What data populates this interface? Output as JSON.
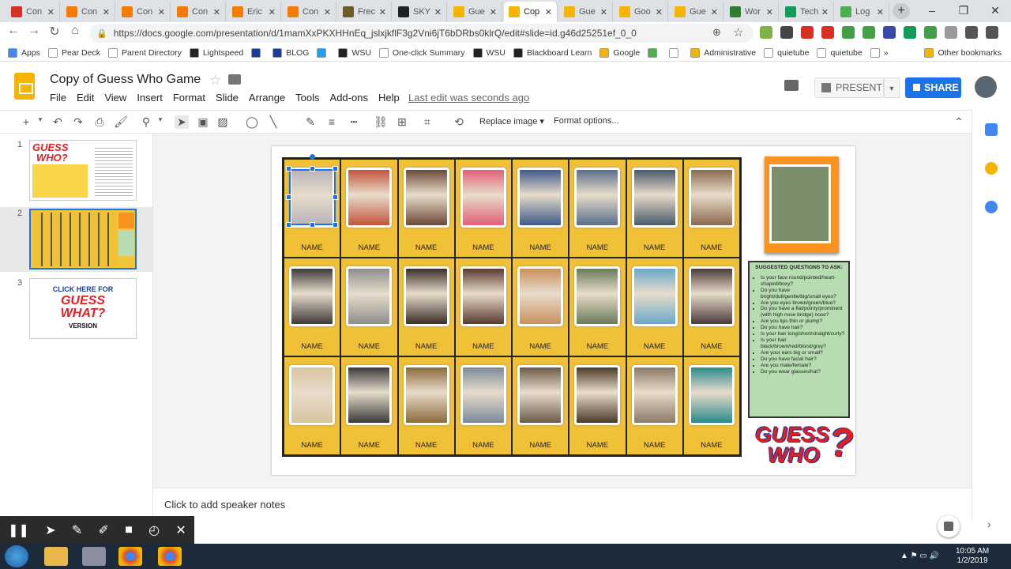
{
  "browser": {
    "tabs": [
      {
        "label": "Con",
        "color": "#d93025"
      },
      {
        "label": "Con",
        "color": "#f57c00"
      },
      {
        "label": "Con",
        "color": "#f57c00"
      },
      {
        "label": "Con",
        "color": "#f57c00"
      },
      {
        "label": "Eric",
        "color": "#f57c00"
      },
      {
        "label": "Con",
        "color": "#f57c00"
      },
      {
        "label": "Frec",
        "color": "#6d5a2a"
      },
      {
        "label": "SKY",
        "color": "#222222"
      },
      {
        "label": "Gue",
        "color": "#f4b400"
      },
      {
        "label": "Cop",
        "color": "#f4b400",
        "active": true
      },
      {
        "label": "Gue",
        "color": "#f4b400"
      },
      {
        "label": "Goo",
        "color": "#f4b400"
      },
      {
        "label": "Gue",
        "color": "#f4b400"
      },
      {
        "label": "Wor",
        "color": "#2e7d32"
      },
      {
        "label": "Tech",
        "color": "#0f9d58"
      },
      {
        "label": "Log",
        "color": "#4caf50"
      }
    ],
    "url": "https://docs.google.com/presentation/d/1mamXxPKXHHnEq_jslxjkflF3g2Vni6jT6bDRbs0klrQ/edit#slide=id.g46d25251ef_0_0",
    "bookmarks": [
      "Apps",
      "Pear Deck",
      "Parent Directory",
      "Lightspeed",
      "",
      "BLOG",
      "",
      "WSU",
      "One-click Summary",
      "WSU",
      "Blackboard Learn",
      "Google",
      "",
      "",
      "Administrative",
      "quietube",
      "quietube",
      "»",
      "Other bookmarks"
    ]
  },
  "doc": {
    "title": "Copy of Guess Who Game",
    "menus": [
      "File",
      "Edit",
      "View",
      "Insert",
      "Format",
      "Slide",
      "Arrange",
      "Tools",
      "Add-ons",
      "Help"
    ],
    "last_edit": "Last edit was seconds ago",
    "present_label": "PRESENT",
    "share_label": "SHARE"
  },
  "toolbar": {
    "replace_image": "Replace image ▾",
    "format_options": "Format options..."
  },
  "filmstrip": {
    "slides": [
      {
        "num": "1"
      },
      {
        "num": "2"
      },
      {
        "num": "3"
      }
    ],
    "slide1": {
      "logo1": "GUESS",
      "logo2": "WHO?"
    },
    "slide3": {
      "line1": "CLICK HERE FOR",
      "line2": "GUESS",
      "line3": "WHAT?",
      "line4": "VERSION"
    }
  },
  "slide": {
    "cards": [
      {
        "name": "NAME",
        "color": "#b9b3b8"
      },
      {
        "name": "NAME",
        "color": "#c2553a"
      },
      {
        "name": "NAME",
        "color": "#6b4a3a"
      },
      {
        "name": "NAME",
        "color": "#e0607a"
      },
      {
        "name": "NAME",
        "color": "#3e5a8a"
      },
      {
        "name": "NAME",
        "color": "#5a6f8a"
      },
      {
        "name": "NAME",
        "color": "#4a5a6a"
      },
      {
        "name": "NAME",
        "color": "#8a6a4e"
      },
      {
        "name": "NAME",
        "color": "#3e3a3a"
      },
      {
        "name": "NAME",
        "color": "#8e8e8e"
      },
      {
        "name": "NAME",
        "color": "#3a2f2a"
      },
      {
        "name": "NAME",
        "color": "#5a3a30"
      },
      {
        "name": "NAME",
        "color": "#c9905e"
      },
      {
        "name": "NAME",
        "color": "#6a7a5a"
      },
      {
        "name": "NAME",
        "color": "#6aa8c8"
      },
      {
        "name": "NAME",
        "color": "#4a3a3a"
      },
      {
        "name": "NAME",
        "color": "#d8c4a0"
      },
      {
        "name": "NAME",
        "color": "#3a3a3a"
      },
      {
        "name": "NAME",
        "color": "#8a6a3a"
      },
      {
        "name": "NAME",
        "color": "#7a8a9a"
      },
      {
        "name": "NAME",
        "color": "#6a5a4a"
      },
      {
        "name": "NAME",
        "color": "#4a3a2a"
      },
      {
        "name": "NAME",
        "color": "#8a7a6a"
      },
      {
        "name": "NAME",
        "color": "#2a8a8a"
      }
    ],
    "questions_title": "SUGGESTED QUESTIONS TO ASK:",
    "questions": [
      "Is your face round/pointed/heart-shaped/boxy?",
      "Do you have bright/dull/gentle/big/small eyes?",
      "Are you eyes brown/green/blue?",
      "Do you have a flat/pointy/prominent (with high nose bridge) nose?",
      "Are you lips thin or plump?",
      "Do you have hair?",
      "Is your hair long/short/straight/curly?",
      "Is your hair black/brown/red/blond/grey?",
      "Are your ears big or small?",
      "Do you have facial hair?",
      "Are you male/female?",
      "Do you wear glasses/hat?"
    ],
    "logo_line1": "GUESS",
    "logo_line2": "WHO",
    "logo_q": "?"
  },
  "notes": {
    "placeholder": "Click to add speaker notes"
  },
  "taskbar": {
    "time": "10:05 AM",
    "date": "1/2/2019"
  }
}
